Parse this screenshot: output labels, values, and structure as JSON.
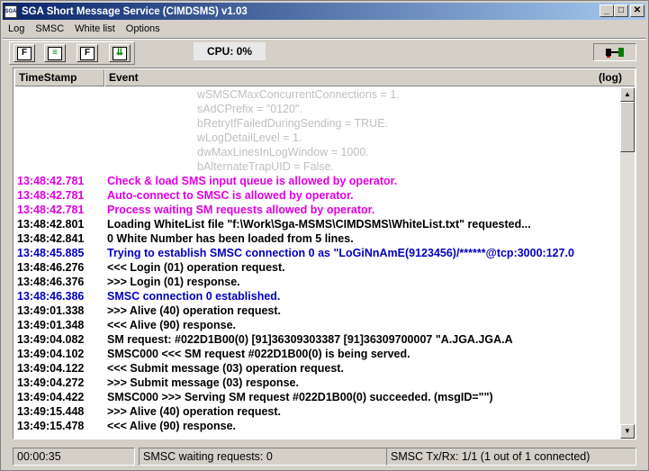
{
  "window": {
    "icon_label": "SGA",
    "title": "SGA Short Message Service (CIMDSMS)  v1.03",
    "minimize_glyph": "_",
    "maximize_glyph": "□",
    "close_glyph": "✕"
  },
  "menu": [
    "Log",
    "SMSC",
    "White list",
    "Options"
  ],
  "toolbar": {
    "buttons": [
      {
        "name": "flag-icon",
        "glyph": "F"
      },
      {
        "name": "traffic-light-icon",
        "glyph": "≡"
      },
      {
        "name": "flag-icon-2",
        "glyph": "F"
      },
      {
        "name": "auto-icon",
        "glyph": "⇊"
      }
    ],
    "cpu_label": "CPU:  0%"
  },
  "log": {
    "headers": {
      "timestamp": "TimeStamp",
      "event": "Event",
      "log": "(log)"
    },
    "rows": [
      {
        "ts": "",
        "ev": "wSMSCMaxConcurrentConnections = 1.",
        "color": "cont"
      },
      {
        "ts": "",
        "ev": "sAdCPrefix = \"0120\".",
        "color": "cont"
      },
      {
        "ts": "",
        "ev": "bRetryIfFailedDuringSending = TRUE.",
        "color": "cont"
      },
      {
        "ts": "",
        "ev": "wLogDetailLevel = 1.",
        "color": "cont"
      },
      {
        "ts": "",
        "ev": "dwMaxLinesInLogWindow = 1000.",
        "color": "cont"
      },
      {
        "ts": "",
        "ev": "bAlternateTrapUID = False.",
        "color": "cont"
      },
      {
        "ts": "13:48:42.781",
        "ev": "Check & load SMS input queue is allowed by operator.",
        "color": "magenta"
      },
      {
        "ts": "13:48:42.781",
        "ev": "Auto-connect to SMSC is allowed by operator.",
        "color": "magenta"
      },
      {
        "ts": "13:48:42.781",
        "ev": "Process waiting SM requests allowed by operator.",
        "color": "magenta"
      },
      {
        "ts": "13:48:42.801",
        "ev": "Loading WhiteList file \"f:\\Work\\Sga-MSMS\\CIMDSMS\\WhiteList.txt\" requested...",
        "color": "black"
      },
      {
        "ts": "13:48:42.841",
        "ev": "0 White Number has been loaded from 5 lines.",
        "color": "black"
      },
      {
        "ts": "13:48:45.885",
        "ev": "Trying to establish SMSC connection 0 as \"LoGiNnAmE(9123456)/******@tcp:3000:127.0",
        "color": "blue"
      },
      {
        "ts": "13:48:46.276",
        "ev": "<<< Login (01) operation request.",
        "color": "black"
      },
      {
        "ts": "13:48:46.376",
        "ev": ">>> Login (01) response.",
        "color": "black"
      },
      {
        "ts": "13:48:46.386",
        "ev": "SMSC connection 0 established.",
        "color": "blue"
      },
      {
        "ts": "13:49:01.338",
        "ev": ">>> Alive (40) operation request.",
        "color": "black"
      },
      {
        "ts": "13:49:01.348",
        "ev": "<<< Alive (90) response.",
        "color": "black"
      },
      {
        "ts": "13:49:04.082",
        "ev": "SM request:      #022D1B00(0)      [91]36309303387          [91]36309700007      \"A.JGA.JGA.A",
        "color": "black"
      },
      {
        "ts": "13:49:04.102",
        "ev": "SMSC000 <<<  SM request #022D1B00(0) is being served.",
        "color": "black"
      },
      {
        "ts": "13:49:04.122",
        "ev": "<<< Submit message (03) operation request.",
        "color": "black"
      },
      {
        "ts": "13:49:04.272",
        "ev": ">>> Submit message (03) response.",
        "color": "black"
      },
      {
        "ts": "13:49:04.422",
        "ev": "SMSC000 >>>  Serving SM request #022D1B00(0) succeeded.  (msgID=\"\")",
        "color": "black"
      },
      {
        "ts": "13:49:15.448",
        "ev": ">>> Alive (40) operation request.",
        "color": "black"
      },
      {
        "ts": "13:49:15.478",
        "ev": "<<< Alive (90) response.",
        "color": "black"
      }
    ]
  },
  "scrollbar": {
    "up_glyph": "▲",
    "down_glyph": "▼"
  },
  "status": {
    "elapsed": "00:00:35",
    "waiting": "SMSC waiting requests: 0",
    "txrx": "SMSC Tx/Rx: 1/1  (1 out of 1 connected)"
  },
  "colors": {
    "title_start": "#0a246a",
    "title_end": "#a6caf0",
    "magenta": "#e000e0",
    "blue": "#0000c0",
    "continuation": "#c0c0c0"
  }
}
